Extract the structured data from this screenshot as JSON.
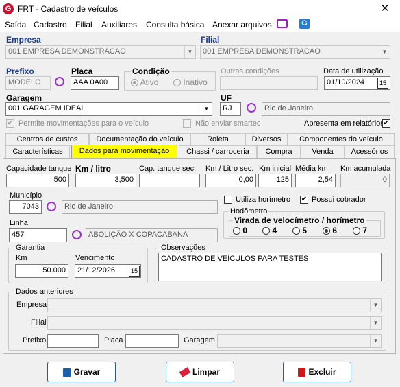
{
  "window": {
    "title": "FRT - Cadastro de veículos",
    "app_icon": "G",
    "close": "✕"
  },
  "menu": {
    "items": [
      "Saída",
      "Cadastro",
      "Filial",
      "Auxiliares",
      "Consulta básica",
      "Anexar arquivos"
    ]
  },
  "empresa": {
    "label": "Empresa",
    "value": "001 EMPRESA DEMONSTRACAO"
  },
  "filial": {
    "label": "Filial",
    "value": "001 EMPRESA DEMONSTRACAO"
  },
  "prefixo": {
    "label": "Prefixo",
    "value": "MODELO"
  },
  "placa": {
    "label": "Placa",
    "value": "AAA 0A00"
  },
  "condicao": {
    "label": "Condição",
    "ativo": "Ativo",
    "inativo": "Inativo"
  },
  "outras": {
    "label": "Outras condições",
    "value": ""
  },
  "data_utilizacao": {
    "label": "Data de utilização",
    "value": "01/10/2024",
    "cal": "15"
  },
  "garagem": {
    "label": "Garagem",
    "value": "001 GARAGEM IDEAL"
  },
  "uf": {
    "label": "UF",
    "value": "RJ",
    "desc": "Rio de Janeiro"
  },
  "checks": {
    "permite": "Permite movimentações para o veículo",
    "nao_enviar": "Não enviar smartec",
    "apresenta": "Apresenta em relatórios"
  },
  "tabs_row1": [
    "Centros de custos",
    "Documentação do veículo",
    "Roleta",
    "Diversos",
    "Componentes do veículo"
  ],
  "tabs_row2": [
    "Características",
    "Dados para movimentação",
    "Chassi / carroceria",
    "Compra",
    "Venda",
    "Acessórios"
  ],
  "mov": {
    "cap_tanque": {
      "label": "Capacidade tanque",
      "value": "500"
    },
    "km_litro": {
      "label": "Km / litro",
      "value": "3,500"
    },
    "cap_tanque_sec": {
      "label": "Cap. tanque sec.",
      "value": ""
    },
    "km_litro_sec": {
      "label": "Km / Litro sec.",
      "value": "0,00"
    },
    "km_inicial": {
      "label": "Km inicial",
      "value": "125"
    },
    "media_km": {
      "label": "Média km",
      "value": "2,54"
    },
    "km_acumulada": {
      "label": "Km acumulada",
      "value": "0"
    },
    "municipio": {
      "label": "Município",
      "code": "7043",
      "desc": "Rio de Janeiro"
    },
    "linha": {
      "label": "Linha",
      "code": "457",
      "desc": "ABOLIÇÃO X COPACABANA"
    },
    "utiliza_horimetro": "Utiliza horímetro",
    "possui_cobrador": "Possui cobrador",
    "hodometro": {
      "title": "Hodômetro",
      "virada_label": "Virada de velocímetro / horímetro",
      "options": [
        "0",
        "4",
        "5",
        "6",
        "7"
      ],
      "selected": "6"
    },
    "garantia": {
      "title": "Garantia",
      "km_label": "Km",
      "km_value": "50.000",
      "venc_label": "Vencimento",
      "venc_value": "21/12/2026",
      "cal": "15"
    },
    "observacoes": {
      "title": "Observações",
      "value": "CADASTRO DE VEÍCULOS PARA TESTES"
    },
    "dados_anteriores": {
      "title": "Dados anteriores",
      "empresa": "Empresa",
      "filial": "Filial",
      "prefixo": "Prefixo",
      "placa": "Placa",
      "garagem": "Garagem"
    }
  },
  "buttons": {
    "gravar": "Gravar",
    "limpar": "Limpar",
    "excluir": "Excluir"
  }
}
